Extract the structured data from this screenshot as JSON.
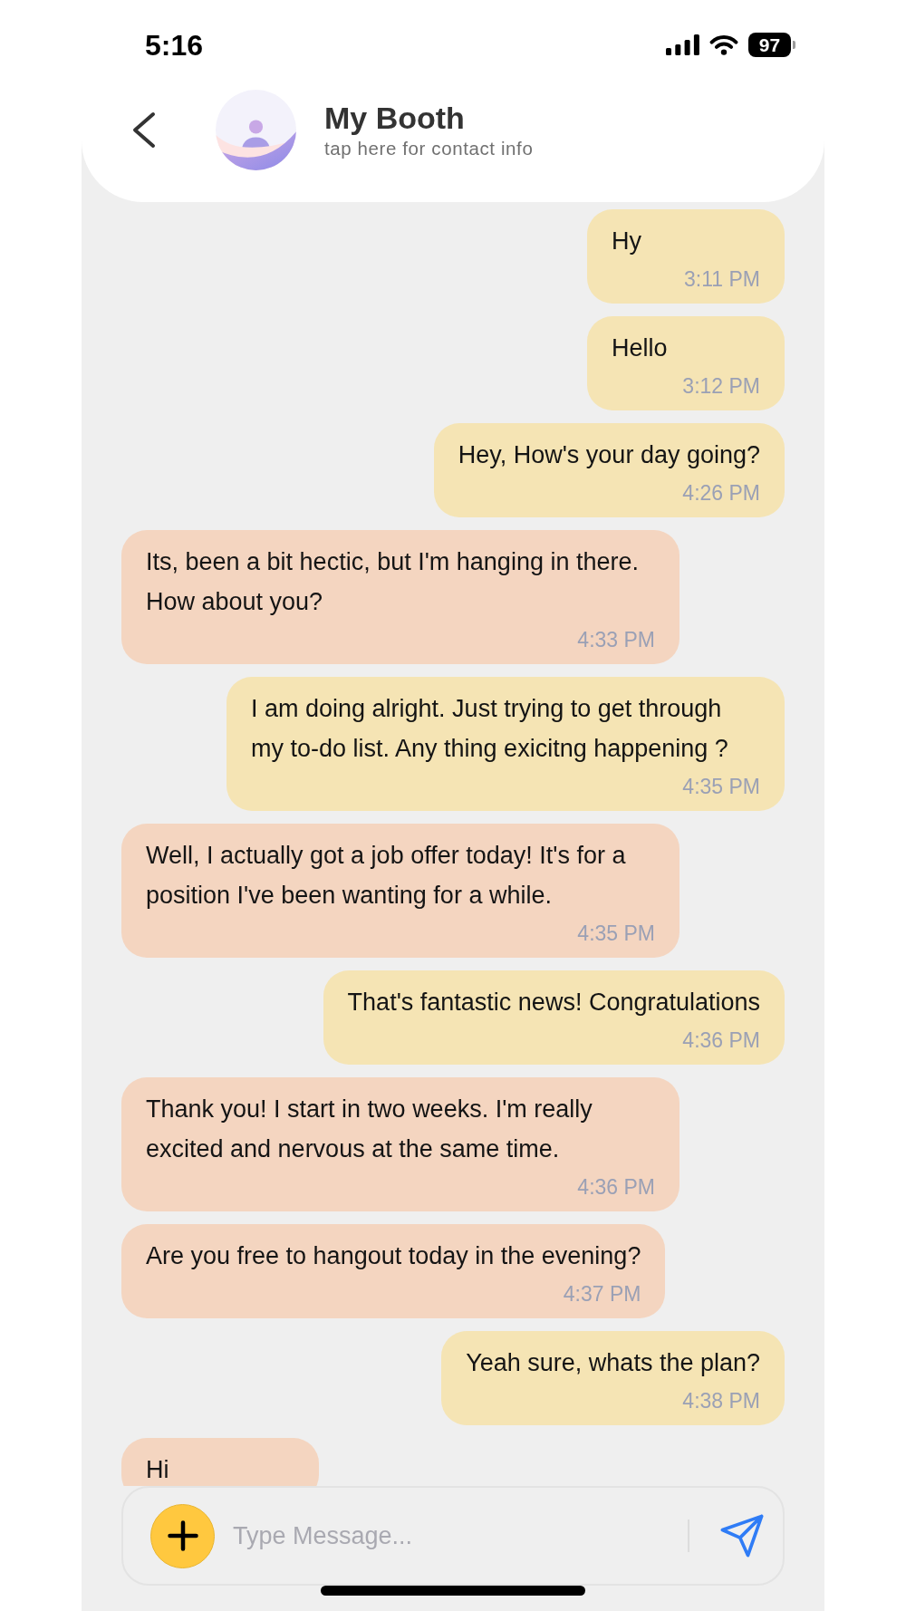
{
  "status_bar": {
    "time": "5:16",
    "battery": "97"
  },
  "header": {
    "title": "My Booth",
    "subtitle": "tap here for contact info"
  },
  "messages": [
    {
      "kind": "sent",
      "text": "Hy",
      "time": "3:11 PM"
    },
    {
      "kind": "sent",
      "text": "Hello",
      "time": "3:12 PM"
    },
    {
      "kind": "sent",
      "text": "Hey, How's your day going?",
      "time": "4:26 PM"
    },
    {
      "kind": "received",
      "text": "Its, been a bit hectic, but I'm hanging in there. How about you?",
      "time": "4:33 PM"
    },
    {
      "kind": "sent",
      "text": "I am doing alright. Just trying to get through my to-do list. Any thing exicitng happening ?",
      "time": "4:35 PM"
    },
    {
      "kind": "received",
      "text": "Well, I actually got a job offer today! It's for a position I've been wanting for a while.",
      "time": "4:35 PM"
    },
    {
      "kind": "sent",
      "text": "That's fantastic news! Congratulations",
      "time": "4:36 PM"
    },
    {
      "kind": "received",
      "text": "Thank you! I start in two weeks. I'm really excited and nervous at the same time.",
      "time": "4:36 PM"
    },
    {
      "kind": "received",
      "text": "Are you free to hangout today in the evening?",
      "time": "4:37 PM"
    },
    {
      "kind": "sent",
      "text": "Yeah sure, whats the plan?",
      "time": "4:38 PM"
    },
    {
      "kind": "received",
      "text": "Hi"
    }
  ],
  "composer": {
    "placeholder": "Type Message..."
  }
}
